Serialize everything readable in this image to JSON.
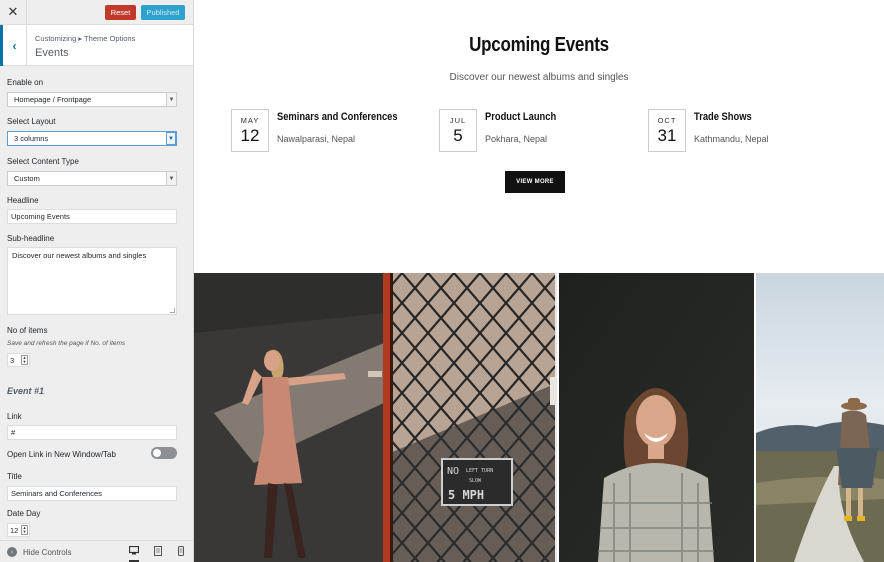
{
  "topbar": {
    "close_icon": "close-icon",
    "reset_label": "Reset",
    "publish_label": "Published"
  },
  "section": {
    "breadcrumb": "Customizing ▸ Theme Options",
    "title": "Events"
  },
  "controls": {
    "enable_on": {
      "label": "Enable on",
      "value": "Homepage / Frontpage"
    },
    "layout": {
      "label": "Select Layout",
      "value": "3 columns"
    },
    "content_type": {
      "label": "Select Content Type",
      "value": "Custom"
    },
    "headline": {
      "label": "Headline",
      "value": "Upcoming Events"
    },
    "subheadline": {
      "label": "Sub-headline",
      "value": "Discover our newest albums and singles"
    },
    "items": {
      "label": "No of items",
      "note": "Save and refresh the page if No. of items",
      "value": "3"
    },
    "event_heading": "Event #1",
    "link": {
      "label": "Link",
      "value": "#"
    },
    "new_window": {
      "label": "Open Link in New Window/Tab",
      "on": false
    },
    "title": {
      "label": "Title",
      "value": "Seminars and Conferences"
    },
    "date_day": {
      "label": "Date Day",
      "value": "12"
    }
  },
  "footer": {
    "hide_label": "Hide Controls"
  },
  "preview": {
    "headline": "Upcoming Events",
    "subheadline": "Discover our newest albums and singles",
    "events": [
      {
        "month": "MAY",
        "day": "12",
        "title": "Seminars and Conferences",
        "location": "Nawalparasi, Nepal"
      },
      {
        "month": "JUL",
        "day": "5",
        "title": "Product Launch",
        "location": "Pokhara, Nepal"
      },
      {
        "month": "OCT",
        "day": "31",
        "title": "Trade Shows",
        "location": "Kathmandu, Nepal"
      }
    ],
    "view_more": "VIEW MORE",
    "sign": {
      "line1": "NO",
      "line2": "LEFT TURN",
      "line3": "SLOW",
      "line4": "5 MPH"
    }
  }
}
